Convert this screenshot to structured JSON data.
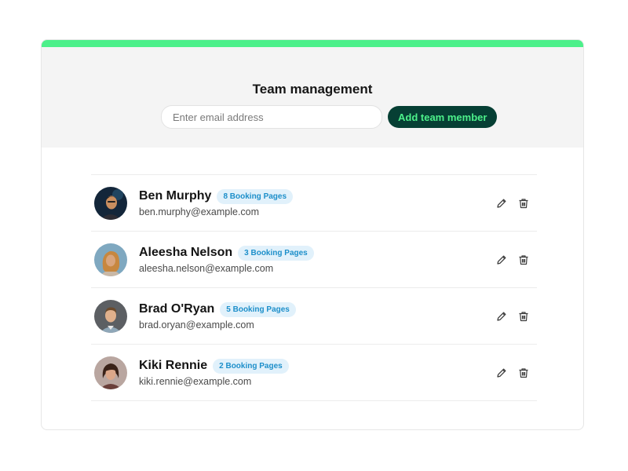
{
  "header": {
    "title": "Team management",
    "email_placeholder": "Enter email address",
    "add_button_label": "Add team member"
  },
  "colors": {
    "accent": "#4cf08a",
    "button_bg": "#063f34",
    "badge_bg": "#e1f1fb",
    "badge_text": "#1d8fca"
  },
  "members": [
    {
      "name": "Ben Murphy",
      "email": "ben.murphy@example.com",
      "badge": "8 Booking Pages",
      "edit_icon": "pencil-icon",
      "delete_icon": "trash-icon"
    },
    {
      "name": "Aleesha Nelson",
      "email": "aleesha.nelson@example.com",
      "badge": "3 Booking Pages",
      "edit_icon": "pencil-icon",
      "delete_icon": "trash-icon"
    },
    {
      "name": "Brad O'Ryan",
      "email": "brad.oryan@example.com",
      "badge": "5 Booking Pages",
      "edit_icon": "pencil-icon",
      "delete_icon": "trash-icon"
    },
    {
      "name": "Kiki Rennie",
      "email": "kiki.rennie@example.com",
      "badge": "2 Booking Pages",
      "edit_icon": "pencil-icon",
      "delete_icon": "trash-icon"
    }
  ]
}
